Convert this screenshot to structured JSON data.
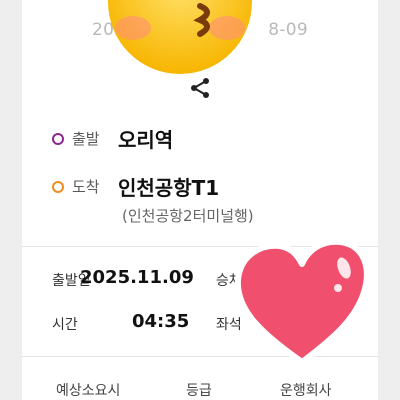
{
  "ticket": {
    "date_left": "202",
    "date_right": "8-09",
    "departure": {
      "label": "출발",
      "station": "오리역"
    },
    "arrival": {
      "label": "도착",
      "station": "인천공항T1",
      "direction": "(인천공항2터미널행)"
    },
    "info": {
      "date_label": "출발일",
      "date_value": "2025.11.09",
      "time_label": "시간",
      "time_value": "04:35",
      "boarding_label": "승차",
      "seat_label": "좌석"
    },
    "bottom": {
      "duration_label": "예상소요시",
      "grade_label": "등급",
      "company_label": "운행회사"
    }
  },
  "icons": {
    "share": "share-icon",
    "emoji": "kissing-face-emoji",
    "heart": "heart-sticker"
  },
  "colors": {
    "departure_dot": "#8a2a8e",
    "arrival_dot": "#f08c1e",
    "heart": "#f0506e"
  }
}
